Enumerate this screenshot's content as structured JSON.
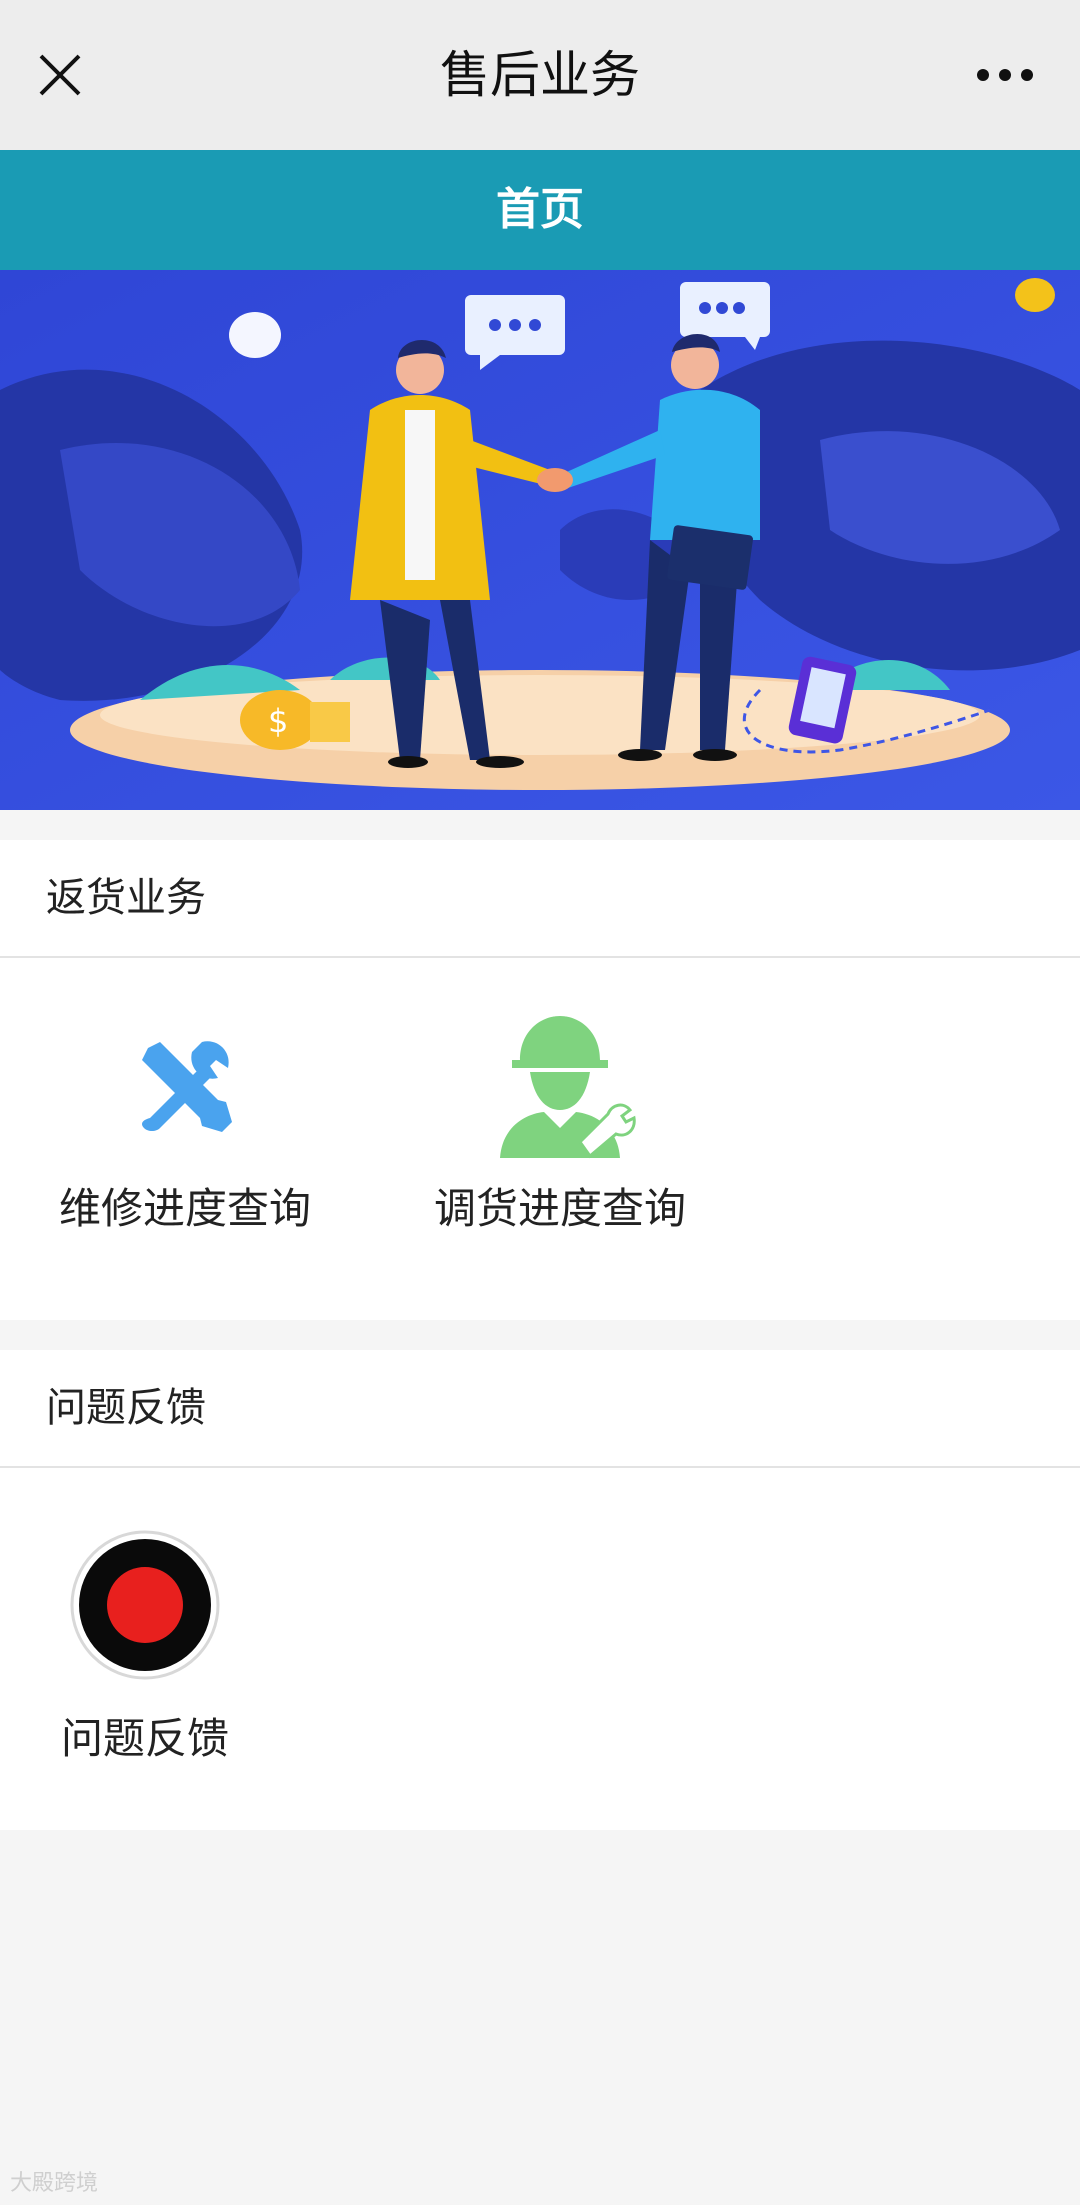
{
  "header": {
    "title": "售后业务",
    "close_icon": "close-icon",
    "more_icon": "more-dots-icon"
  },
  "nav": {
    "home_label": "首页",
    "color": "#1a9bb4"
  },
  "banner": {
    "description_icon": "handshake-illustration"
  },
  "sections": {
    "returns": {
      "title": "返货业务",
      "items": [
        {
          "label": "维修进度查询",
          "icon": "tools-icon",
          "color": "#4aa3ee"
        },
        {
          "label": "调货进度查询",
          "icon": "worker-icon",
          "color": "#7fd37f"
        }
      ]
    },
    "feedback": {
      "title": "问题反馈",
      "items": [
        {
          "label": "问题反馈",
          "icon": "record-icon",
          "color": "#e8201e"
        }
      ]
    }
  },
  "watermark": "大殿跨境"
}
